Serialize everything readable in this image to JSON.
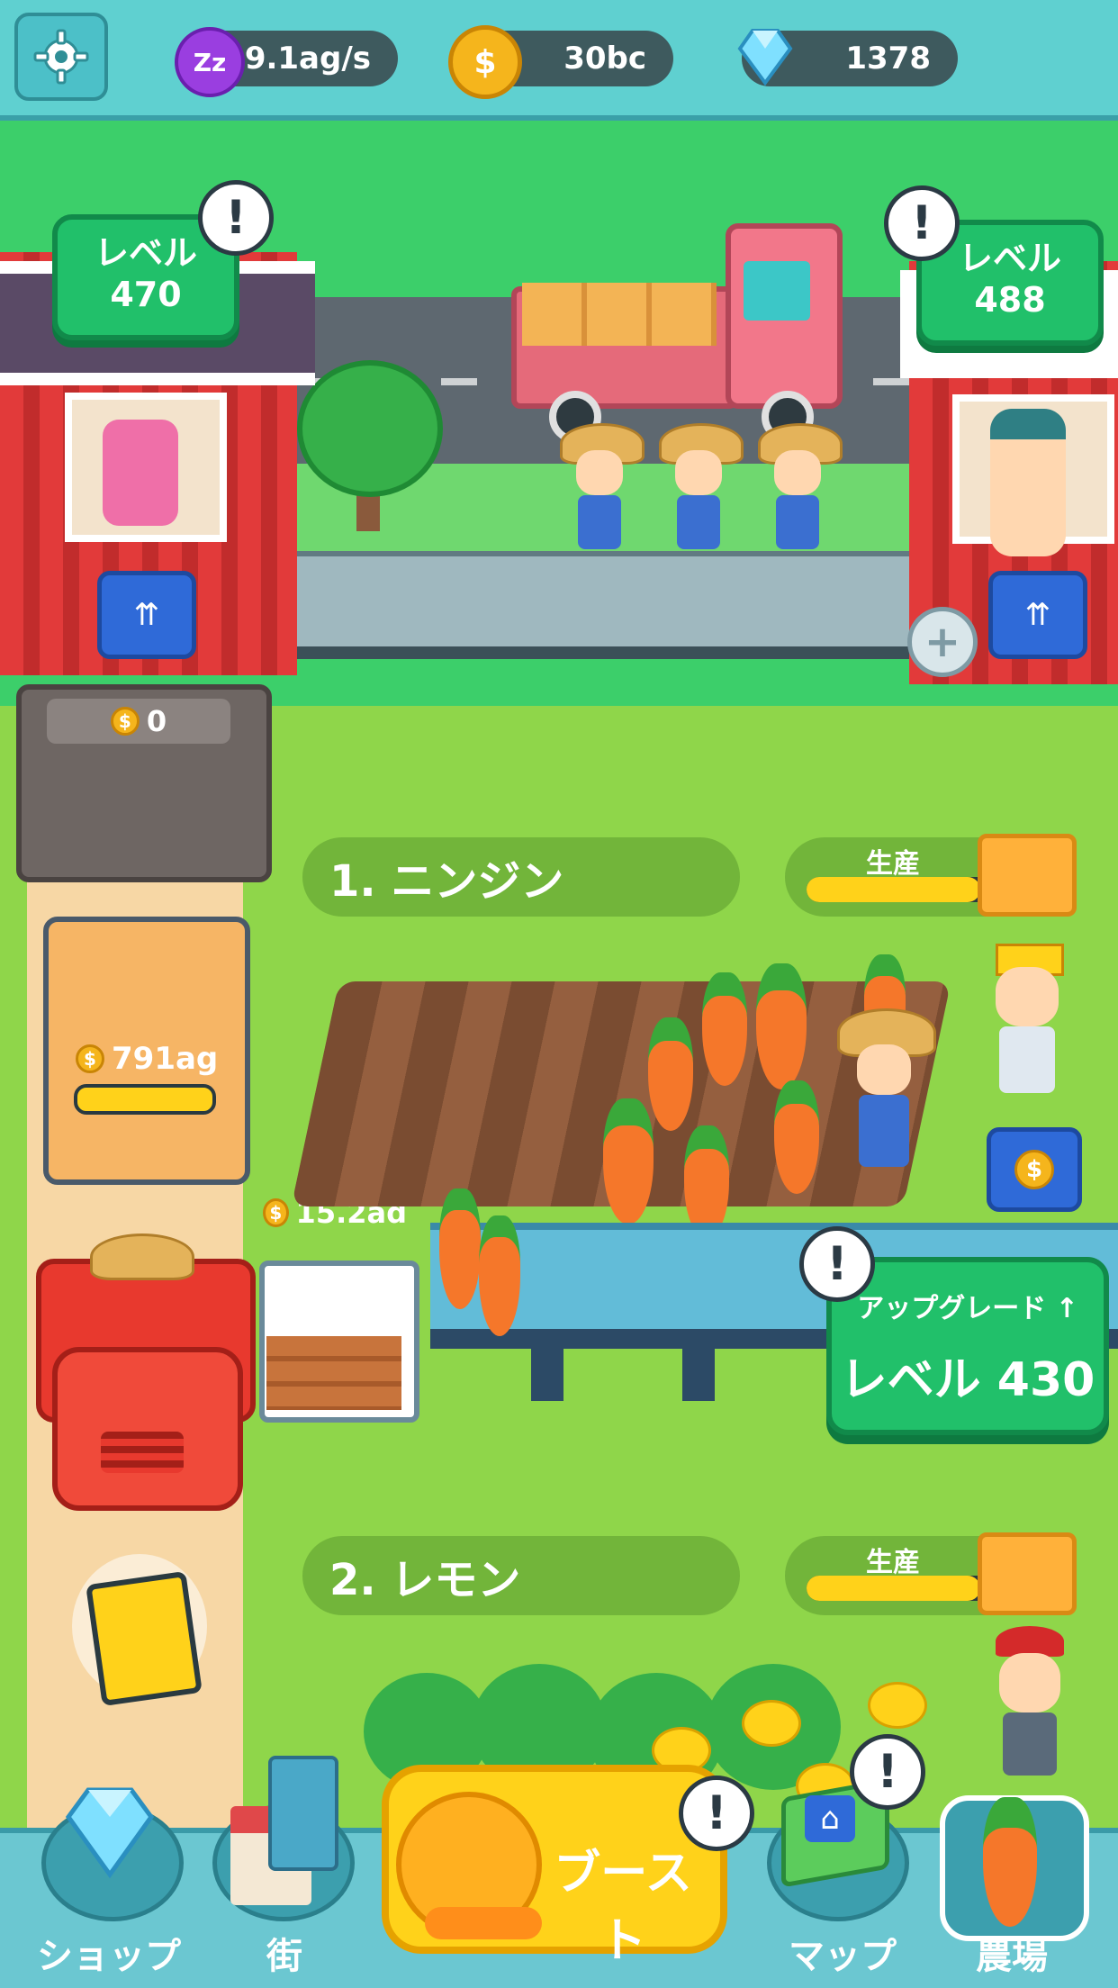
{
  "hud": {
    "idle_rate": "9.1ag/s",
    "coins": "30bc",
    "gems": "1378",
    "icons": [
      "gear-icon",
      "sleep-zzz-icon",
      "coin-icon",
      "diamond-icon"
    ]
  },
  "buildings": {
    "left": {
      "level_label": "レベル",
      "level_value": "470"
    },
    "right": {
      "level_label": "レベル",
      "level_value": "488"
    }
  },
  "gate": {
    "value": "0"
  },
  "truck": {
    "value": "791ag"
  },
  "crate": {
    "value": "15.2ad"
  },
  "rows": [
    {
      "label": "1. ニンジン",
      "production_label": "生産",
      "production_progress": 0.92,
      "upgrade_label": "アップグレード",
      "upgrade_level": "レベル 430"
    },
    {
      "label": "2. レモン",
      "production_label": "生産",
      "production_progress": 0.92
    }
  ],
  "nav": {
    "shop": "ショップ",
    "town": "街",
    "boost": "ブースト",
    "map": "マップ",
    "farm": "農場"
  },
  "colors": {
    "accent_green": "#21c06a",
    "gold": "#ffd21a",
    "sky": "#5fd0d0"
  }
}
